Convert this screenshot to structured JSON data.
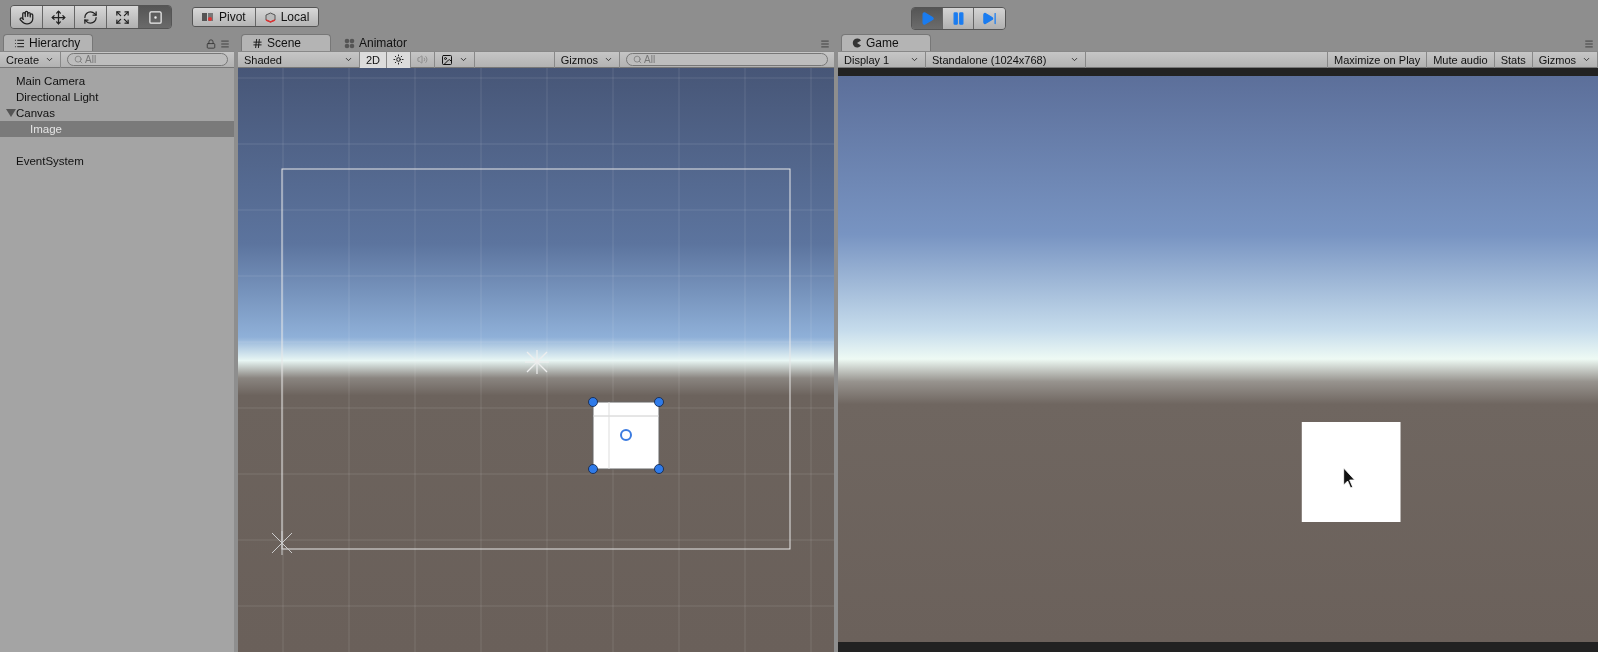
{
  "toolbar": {
    "tools": [
      {
        "kind": "hand",
        "selected": false
      },
      {
        "kind": "move",
        "selected": false
      },
      {
        "kind": "rotate",
        "selected": false
      },
      {
        "kind": "scale",
        "selected": false
      },
      {
        "kind": "rect",
        "selected": true
      }
    ],
    "pivot_buttons": [
      {
        "kind": "pivot",
        "label": "Pivot"
      },
      {
        "kind": "local",
        "label": "Local"
      }
    ],
    "playback": [
      {
        "kind": "play",
        "selected": true
      },
      {
        "kind": "pause",
        "selected": false
      },
      {
        "kind": "step",
        "selected": false
      }
    ]
  },
  "hierarchy": {
    "tab": "Hierarchy",
    "create": "Create",
    "search": {
      "placeholder": "All"
    },
    "items": [
      {
        "label": "Main Camera",
        "selected": false
      },
      {
        "label": "Directional Light",
        "selected": false
      },
      {
        "label": "Canvas",
        "selected": false,
        "expanded": true,
        "children": [
          {
            "label": "Image",
            "selected": true
          }
        ]
      },
      {
        "label": "EventSystem",
        "selected": false
      }
    ]
  },
  "scene": {
    "tabs": [
      {
        "label": "Scene",
        "kind": "scene",
        "selected": true
      },
      {
        "label": "Animator",
        "kind": "animator",
        "selected": false
      }
    ],
    "shading": "Shaded",
    "mode_2d": {
      "label": "2D",
      "on": true
    },
    "lighting_on": true,
    "audio_on": false,
    "gizmos": "Gizmos",
    "search": {
      "placeholder": "All"
    }
  },
  "game": {
    "tab": "Game",
    "display": "Display 1",
    "resolution": "Standalone (1024x768)",
    "options": [
      {
        "label": "Maximize on Play",
        "on": false
      },
      {
        "label": "Mute audio",
        "on": false
      },
      {
        "label": "Stats",
        "on": false
      }
    ],
    "gizmos": "Gizmos"
  }
}
